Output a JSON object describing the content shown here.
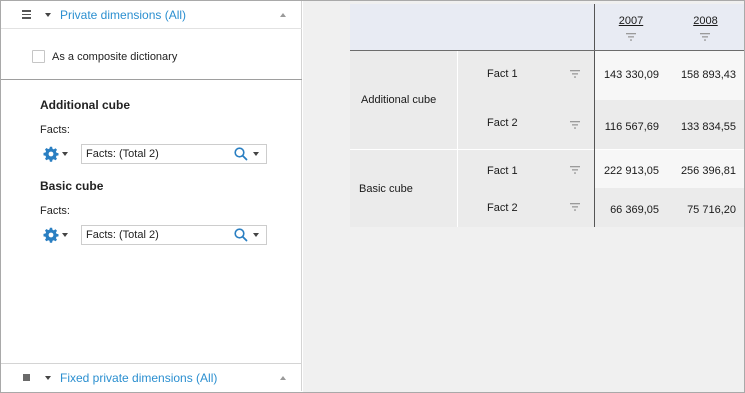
{
  "left_panel": {
    "top_section": {
      "title": "Private dimensions (All)"
    },
    "composite_checkbox": {
      "label": "As a composite dictionary",
      "checked": false
    },
    "cubes": [
      {
        "title": "Additional cube",
        "facts_label": "Facts:",
        "combo_prefix": "Facts:",
        "combo_value": "(Total 2)"
      },
      {
        "title": "Basic cube",
        "facts_label": "Facts:",
        "combo_prefix": "Facts:",
        "combo_value": "(Total 2)"
      }
    ],
    "bottom_section": {
      "title": "Fixed private dimensions (All)"
    }
  },
  "table": {
    "columns": [
      "2007",
      "2008"
    ],
    "rows": [
      {
        "cube": "Additional cube",
        "fact": "Fact 1",
        "values": [
          "143 330,09",
          "158 893,43"
        ]
      },
      {
        "cube": "",
        "fact": "Fact 2",
        "values": [
          "116 567,69",
          "133 834,55"
        ]
      },
      {
        "cube": "Basic cube",
        "fact": "Fact 1",
        "values": [
          "222 913,05",
          "256 396,81"
        ]
      },
      {
        "cube": "",
        "fact": "Fact 2",
        "values": [
          "66 369,05",
          "75 716,20"
        ]
      }
    ]
  },
  "colors": {
    "accent": "#2b8fd0",
    "header_bg": "#e8ebf3",
    "row_light": "#f7f7f7",
    "row_dark": "#ebebeb"
  },
  "icons": [
    "hamburger-icon",
    "gear-icon",
    "search-icon",
    "filter-icon",
    "chevron-down-icon",
    "chevron-up-icon"
  ]
}
